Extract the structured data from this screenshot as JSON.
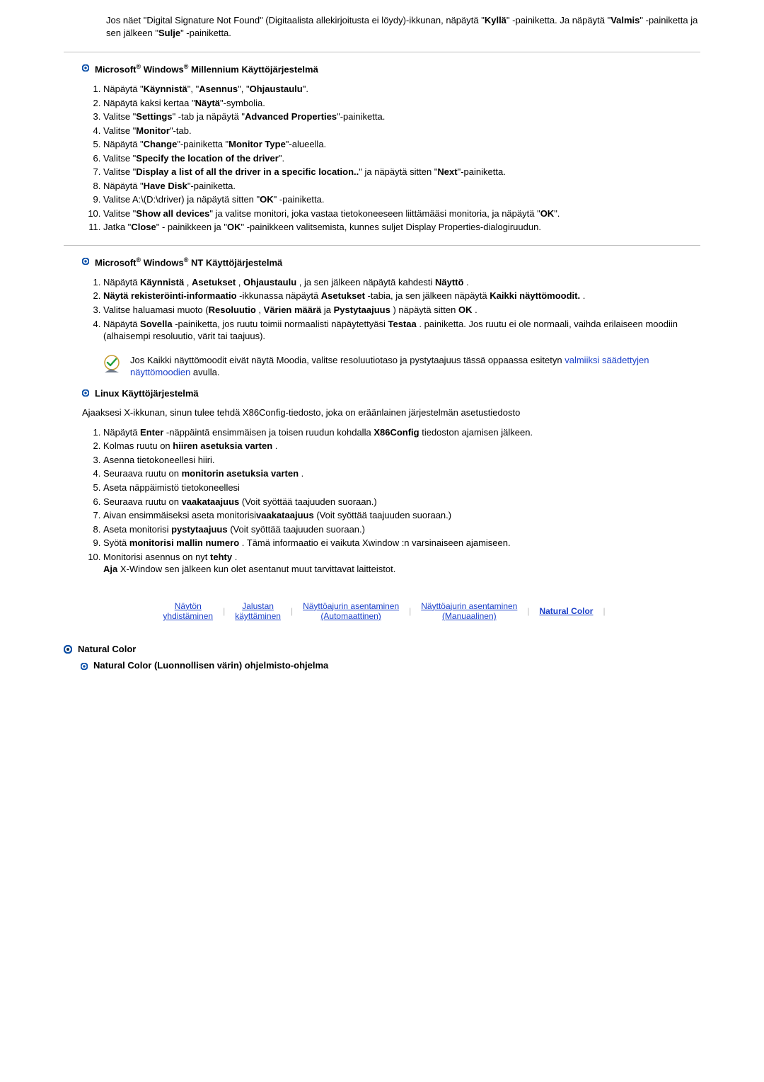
{
  "intro": "Jos näet \"Digital Signature Not Found\" (Digitaalista allekirjoitusta ei löydy)-ikkunan, näpäytä \"<b>Kyllä</b>\" -painiketta. Ja näpäytä \"<b>Valmis</b>\" -painiketta ja sen jälkeen \"<b>Sulje</b>\" -painiketta.",
  "section_me_title": "Microsoft<sup>®</sup> Windows<sup>®</sup> Millennium Käyttöjärjestelmä",
  "steps_me": [
    "Näpäytä \"<b>Käynnistä</b>\", \"<b>Asennus</b>\", \"<b>Ohjaustaulu</b>\".",
    "Näpäytä kaksi kertaa \"<b>Näytä</b>\"-symbolia.",
    "Valitse \"<b>Settings</b>\" -tab ja näpäytä \"<b>Advanced Properties</b>\"-painiketta.",
    "Valitse \"<b>Monitor</b>\"-tab.",
    "Näpäytä \"<b>Change</b>\"-painiketta \"<b>Monitor Type</b>\"-alueella.",
    "Valitse \"<b>Specify the location of the driver</b>\".",
    "Valitse \"<b>Display a list of all the driver in a specific location..</b>\" ja näpäytä sitten \"<b>Next</b>\"-painiketta.",
    "Näpäytä \"<b>Have Disk</b>\"-painiketta.",
    "Valitse A:\\(D:\\driver) ja näpäytä sitten \"<b>OK</b>\" -painiketta.",
    "Valitse \"<b>Show all devices</b>\" ja valitse monitori, joka vastaa tietokoneeseen liittämääsi monitoria, ja näpäytä \"<b>OK</b>\".",
    "Jatka \"<b>Close</b>\" - painikkeen ja \"<b>OK</b>\" -painikkeen valitsemista, kunnes suljet Display Properties-dialogiruudun."
  ],
  "section_nt_title": "Microsoft<sup>®</sup> Windows<sup>®</sup> NT Käyttöjärjestelmä",
  "steps_nt": [
    "Näpäytä <b>Käynnistä</b> , <b>Asetukset</b> , <b>Ohjaustaulu</b> , ja sen jälkeen näpäytä kahdesti <b>Näyttö</b> .",
    "<b>Näytä rekisteröinti-informaatio</b> -ikkunassa näpäytä <b>Asetukset</b> -tabia, ja sen jälkeen näpäytä <b>Kaikki näyttömoodit.</b> .",
    "Valitse haluamasi muoto (<b>Resoluutio</b> , <b>Värien määrä</b> ja <b>Pystytaajuus</b> ) näpäytä sitten <b>OK</b> .",
    "Näpäytä <b>Sovella</b> -painiketta, jos ruutu toimii normaalisti näpäytettyäsi <b>Testaa</b> . painiketta. Jos ruutu ei ole normaali, vaihda erilaiseen moodiin (alhaisempi resoluutio, värit tai taajuus)."
  ],
  "nt_note_prefix": "Jos Kaikki näyttömoodit eivät näytä Moodia, valitse resoluutiotaso ja pystytaajuus tässä oppaassa esitetyn ",
  "nt_note_link": "valmiiksi säädettyjen näyttömoodien",
  "nt_note_suffix": " avulla.",
  "section_linux_title": "Linux Käyttöjärjestelmä",
  "linux_intro": "Ajaaksesi X-ikkunan, sinun tulee tehdä X86Config-tiedosto, joka on eräänlainen järjestelmän asetustiedosto",
  "steps_linux": [
    "Näpäytä <b>Enter</b> -näppäintä ensimmäisen ja toisen ruudun kohdalla <b>X86Config</b> tiedoston ajamisen jälkeen.",
    "Kolmas ruutu on <b>hiiren asetuksia varten</b> .",
    "Asenna tietokoneellesi hiiri.",
    "Seuraava ruutu on <b>monitorin asetuksia varten</b> .",
    "Aseta näppäimistö tietokoneellesi",
    "Seuraava ruutu on <b>vaakataajuus</b> (Voit syöttää taajuuden suoraan.)",
    "Aivan ensimmäiseksi aseta monitorisi<b>vaakataajuus</b> (Voit syöttää taajuuden suoraan.)",
    "Aseta monitorisi <b>pystytaajuus</b> (Voit syöttää taajuuden suoraan.)",
    "Syötä <b>monitorisi mallin numero</b> . Tämä informaatio ei vaikuta Xwindow :n varsinaiseen ajamiseen.",
    "Monitorisi asennus on nyt <b>tehty</b> .<br><b>Aja</b> X-Window sen jälkeen kun olet asentanut muut tarvittavat laitteistot."
  ],
  "nav": {
    "item1_l1": "Näytön",
    "item1_l2": "yhdistäminen",
    "item2_l1": "Jalustan",
    "item2_l2": "käyttäminen",
    "item3_l1": "Näyttöajurin asentaminen",
    "item3_l2": "(Automaattinen)",
    "item4_l1": "Näyttöajurin asentaminen",
    "item4_l2": "(Manuaalinen)",
    "item5": "Natural Color"
  },
  "footer_title": "Natural Color",
  "footer_sub": "Natural Color (Luonnollisen värin) ohjelmisto-ohjelma"
}
